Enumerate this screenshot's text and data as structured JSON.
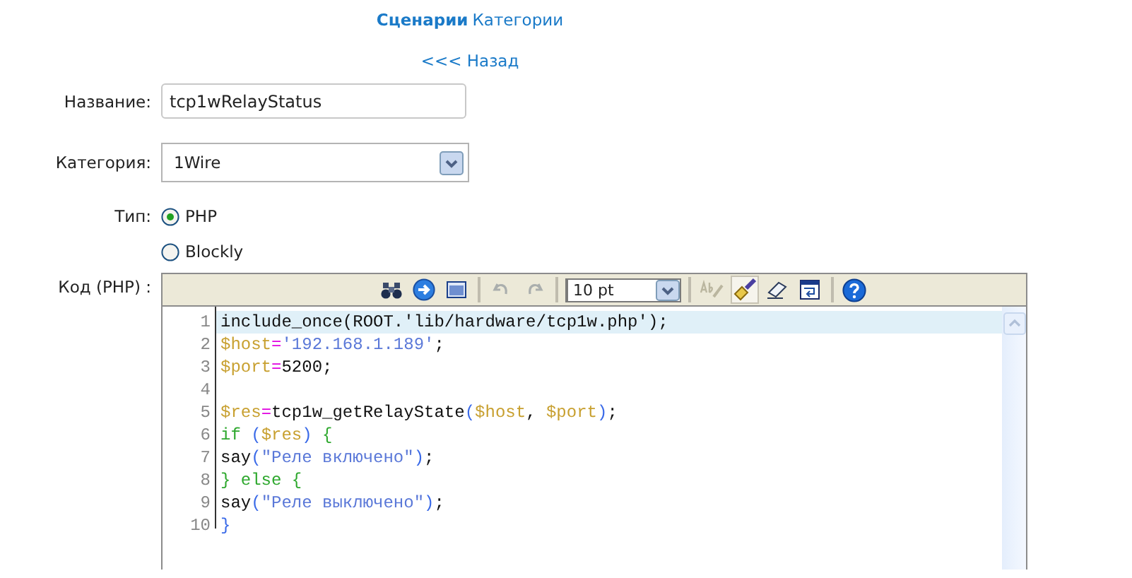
{
  "nav": {
    "links": [
      {
        "label": "Сценарии",
        "selected": true
      },
      {
        "label": "Категории",
        "selected": false
      }
    ],
    "back": "<<< Назад"
  },
  "form": {
    "name": {
      "label": "Название:",
      "value": "tcp1wRelayStatus"
    },
    "category": {
      "label": "Категория:",
      "value": "1Wire"
    },
    "type": {
      "label": "Тип:",
      "options": [
        {
          "label": "PHP",
          "selected": true
        },
        {
          "label": "Blockly",
          "selected": false
        }
      ]
    },
    "code": {
      "label": "Код (PHP) :",
      "toolbar": [
        {
          "kind": "search",
          "disabled": false,
          "on": false
        },
        {
          "kind": "goto",
          "disabled": false,
          "on": false
        },
        {
          "kind": "fullscreen",
          "disabled": false,
          "on": false
        },
        {
          "kind": "sep"
        },
        {
          "kind": "undo",
          "disabled": true,
          "on": false
        },
        {
          "kind": "redo",
          "disabled": true,
          "on": false
        },
        {
          "kind": "sep"
        },
        {
          "kind": "fontsize",
          "value": "10 pt"
        },
        {
          "kind": "sep"
        },
        {
          "kind": "spell",
          "disabled": true,
          "on": false
        },
        {
          "kind": "highlight",
          "disabled": false,
          "on": true
        },
        {
          "kind": "reset",
          "disabled": false,
          "on": false
        },
        {
          "kind": "wrap",
          "disabled": false,
          "on": false
        },
        {
          "kind": "sep"
        },
        {
          "kind": "help",
          "disabled": false,
          "on": false
        }
      ],
      "lines": [
        {
          "number": "1",
          "current": true,
          "tokens": [
            {
              "kind": "plain",
              "text": "include_once(ROOT.'lib/hardware/tcp1w.php');"
            }
          ]
        },
        {
          "number": "2",
          "current": false,
          "tokens": [
            {
              "kind": "var",
              "text": "$host"
            },
            {
              "kind": "op",
              "text": "="
            },
            {
              "kind": "str",
              "text": "'192.168.1.189'"
            },
            {
              "kind": "plain",
              "text": ";"
            }
          ]
        },
        {
          "number": "3",
          "current": false,
          "tokens": [
            {
              "kind": "var",
              "text": "$port"
            },
            {
              "kind": "op",
              "text": "="
            },
            {
              "kind": "plain",
              "text": "5200;"
            }
          ]
        },
        {
          "number": "4",
          "current": false
        },
        {
          "number": "5",
          "current": false,
          "tokens": [
            {
              "kind": "var",
              "text": "$res"
            },
            {
              "kind": "op",
              "text": "="
            },
            {
              "kind": "plain",
              "text": "tcp1w_getRelayState"
            },
            {
              "kind": "punc",
              "text": "("
            },
            {
              "kind": "var",
              "text": "$host"
            },
            {
              "kind": "plain",
              "text": ", "
            },
            {
              "kind": "var",
              "text": "$port"
            },
            {
              "kind": "punc",
              "text": ")"
            },
            {
              "kind": "plain",
              "text": ";"
            }
          ]
        },
        {
          "number": "6",
          "current": false,
          "tokens": [
            {
              "kind": "kw",
              "text": "if "
            },
            {
              "kind": "punc",
              "text": "("
            },
            {
              "kind": "var",
              "text": "$res"
            },
            {
              "kind": "punc",
              "text": ") "
            },
            {
              "kind": "kw",
              "text": "{"
            }
          ]
        },
        {
          "number": "7",
          "current": false,
          "tokens": [
            {
              "kind": "plain",
              "text": "say"
            },
            {
              "kind": "punc",
              "text": "("
            },
            {
              "kind": "str",
              "text": "\"Реле включено\""
            },
            {
              "kind": "punc",
              "text": ")"
            },
            {
              "kind": "plain",
              "text": ";"
            }
          ]
        },
        {
          "number": "8",
          "current": false,
          "tokens": [
            {
              "kind": "kw",
              "text": "} else {"
            }
          ]
        },
        {
          "number": "9",
          "current": false,
          "tokens": [
            {
              "kind": "plain",
              "text": "say"
            },
            {
              "kind": "punc",
              "text": "("
            },
            {
              "kind": "str",
              "text": "\"Реле выключено\""
            },
            {
              "kind": "punc",
              "text": ")"
            },
            {
              "kind": "plain",
              "text": ";"
            }
          ]
        },
        {
          "number": "10",
          "current": false,
          "tokens": [
            {
              "kind": "punc",
              "text": "}"
            }
          ]
        }
      ]
    }
  }
}
